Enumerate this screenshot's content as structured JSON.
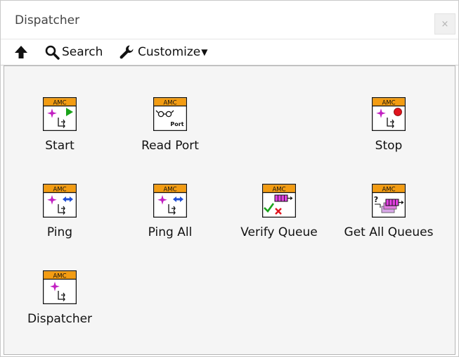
{
  "window": {
    "title": "Dispatcher",
    "close_label": "×"
  },
  "toolbar": {
    "search_label": "Search",
    "customize_label": "Customize",
    "customize_caret": "▼"
  },
  "icon_badge": "AMC",
  "colors": {
    "badge": "#f39c12",
    "magenta": "#c21fc2",
    "green": "#1aa31a",
    "red": "#e0141e",
    "blue": "#1f4fd6"
  },
  "palette": {
    "items": [
      {
        "label": "Start",
        "icon": "amc-start-icon"
      },
      {
        "label": "Read Port",
        "icon": "amc-read-port-icon",
        "sublabel": "Port"
      },
      {
        "label": "Stop",
        "icon": "amc-stop-icon"
      },
      {
        "label": "Ping",
        "icon": "amc-ping-icon"
      },
      {
        "label": "Ping All",
        "icon": "amc-ping-all-icon"
      },
      {
        "label": "Verify Queue",
        "icon": "amc-verify-queue-icon"
      },
      {
        "label": "Get All Queues",
        "icon": "amc-get-all-queues-icon"
      },
      {
        "label": "Dispatcher",
        "icon": "amc-dispatcher-icon"
      }
    ]
  }
}
